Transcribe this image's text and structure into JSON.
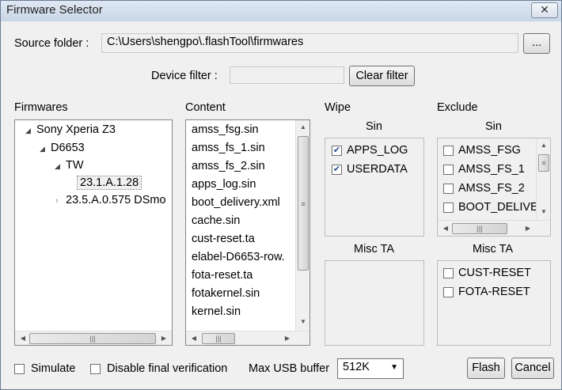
{
  "window": {
    "title": "Firmware Selector",
    "close_label": "✕"
  },
  "source": {
    "label": "Source folder :",
    "path": "C:\\Users\\shengpo\\.flashTool\\firmwares",
    "browse_label": "..."
  },
  "filter": {
    "label": "Device filter :",
    "value": "",
    "button_label": "Clear filter"
  },
  "headers": {
    "firmwares": "Firmwares",
    "content": "Content",
    "wipe": "Wipe",
    "exclude": "Exclude"
  },
  "tree": {
    "nodes": [
      {
        "label": "Sony Xperia Z3"
      },
      {
        "label": "D6653"
      },
      {
        "label": "TW"
      },
      {
        "label": "23.1.A.1.28"
      },
      {
        "label": "23.5.A.0.575 DSmo"
      }
    ]
  },
  "content_list": {
    "items": [
      "amss_fsg.sin",
      "amss_fs_1.sin",
      "amss_fs_2.sin",
      "apps_log.sin",
      "boot_delivery.xml",
      "cache.sin",
      "cust-reset.ta",
      "elabel-D6653-row.",
      "fota-reset.ta",
      "fotakernel.sin",
      "kernel.sin"
    ]
  },
  "wipe": {
    "sin_label": "Sin",
    "sin_items": [
      {
        "label": "APPS_LOG",
        "checked": true
      },
      {
        "label": "USERDATA",
        "checked": true
      }
    ],
    "misc_label": "Misc TA"
  },
  "exclude": {
    "sin_label": "Sin",
    "sin_items": [
      {
        "label": "AMSS_FSG",
        "checked": false
      },
      {
        "label": "AMSS_FS_1",
        "checked": false
      },
      {
        "label": "AMSS_FS_2",
        "checked": false
      },
      {
        "label": "BOOT_DELIVE",
        "checked": false
      }
    ],
    "misc_label": "Misc TA",
    "misc_items": [
      {
        "label": "CUST-RESET",
        "checked": false
      },
      {
        "label": "FOTA-RESET",
        "checked": false
      }
    ]
  },
  "bottom": {
    "simulate_label": "Simulate",
    "disable_verif_label": "Disable final verification",
    "usb_label": "Max USB buffer",
    "usb_value": "512K",
    "flash_label": "Flash",
    "cancel_label": "Cancel"
  }
}
